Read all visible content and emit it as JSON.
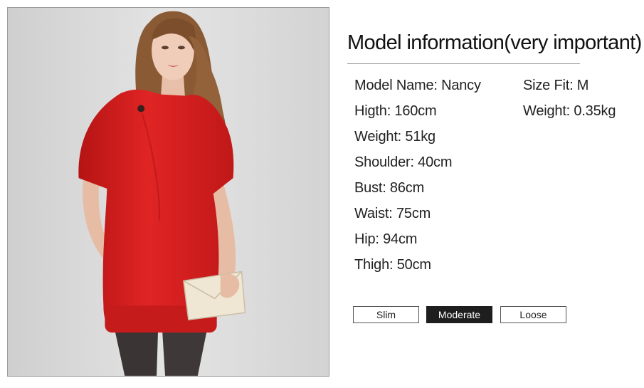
{
  "photo": {
    "alt": "Model wearing red short-sleeve dress holding a beige clutch"
  },
  "info": {
    "title": "Model information(very important)",
    "specs": [
      "Model Name: Nancy",
      "Higth: 160cm",
      "Weight: 51kg",
      "Shoulder: 40cm",
      "Bust: 86cm",
      "Waist: 75cm",
      "Hip: 94cm",
      "Thigh: 50cm"
    ],
    "right_specs": [
      "Size Fit: M",
      "Weight: 0.35kg"
    ]
  },
  "fit": {
    "options": [
      "Slim",
      "Moderate",
      "Loose"
    ],
    "selected": "Moderate"
  },
  "colors": {
    "dress": "#d61f1f",
    "selected_fit_bg": "#1e1e1e"
  }
}
